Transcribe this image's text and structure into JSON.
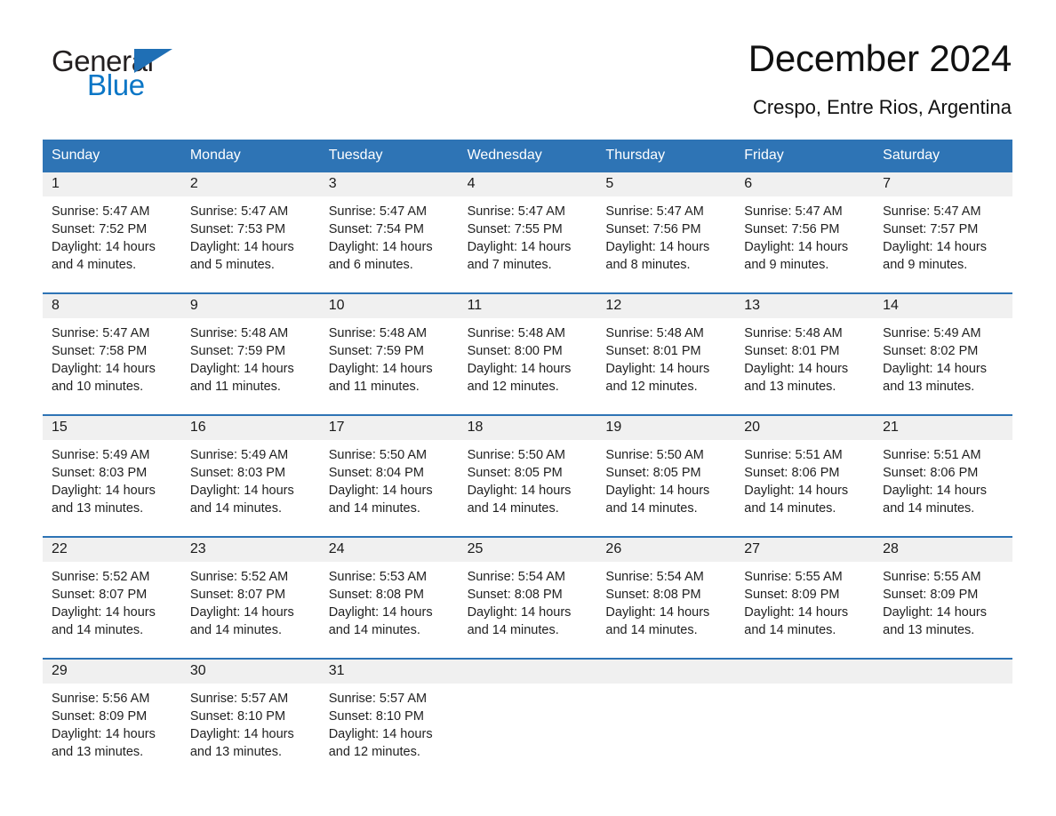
{
  "brand": {
    "name_part1": "General",
    "name_part2": "Blue",
    "logo_icon": "triangle-icon",
    "colors": {
      "blue": "#1f6fb5",
      "text": "#231f20",
      "blue_text": "#0b76c6"
    }
  },
  "header": {
    "title": "December 2024",
    "location": "Crespo, Entre Rios, Argentina"
  },
  "calendar": {
    "accent_color": "#2e74b5",
    "daynum_band_color": "#f0f0f0",
    "weekdays": [
      "Sunday",
      "Monday",
      "Tuesday",
      "Wednesday",
      "Thursday",
      "Friday",
      "Saturday"
    ],
    "weeks": [
      [
        {
          "day": "1",
          "sunrise": "Sunrise: 5:47 AM",
          "sunset": "Sunset: 7:52 PM",
          "daylight_line1": "Daylight: 14 hours",
          "daylight_line2": "and 4 minutes."
        },
        {
          "day": "2",
          "sunrise": "Sunrise: 5:47 AM",
          "sunset": "Sunset: 7:53 PM",
          "daylight_line1": "Daylight: 14 hours",
          "daylight_line2": "and 5 minutes."
        },
        {
          "day": "3",
          "sunrise": "Sunrise: 5:47 AM",
          "sunset": "Sunset: 7:54 PM",
          "daylight_line1": "Daylight: 14 hours",
          "daylight_line2": "and 6 minutes."
        },
        {
          "day": "4",
          "sunrise": "Sunrise: 5:47 AM",
          "sunset": "Sunset: 7:55 PM",
          "daylight_line1": "Daylight: 14 hours",
          "daylight_line2": "and 7 minutes."
        },
        {
          "day": "5",
          "sunrise": "Sunrise: 5:47 AM",
          "sunset": "Sunset: 7:56 PM",
          "daylight_line1": "Daylight: 14 hours",
          "daylight_line2": "and 8 minutes."
        },
        {
          "day": "6",
          "sunrise": "Sunrise: 5:47 AM",
          "sunset": "Sunset: 7:56 PM",
          "daylight_line1": "Daylight: 14 hours",
          "daylight_line2": "and 9 minutes."
        },
        {
          "day": "7",
          "sunrise": "Sunrise: 5:47 AM",
          "sunset": "Sunset: 7:57 PM",
          "daylight_line1": "Daylight: 14 hours",
          "daylight_line2": "and 9 minutes."
        }
      ],
      [
        {
          "day": "8",
          "sunrise": "Sunrise: 5:47 AM",
          "sunset": "Sunset: 7:58 PM",
          "daylight_line1": "Daylight: 14 hours",
          "daylight_line2": "and 10 minutes."
        },
        {
          "day": "9",
          "sunrise": "Sunrise: 5:48 AM",
          "sunset": "Sunset: 7:59 PM",
          "daylight_line1": "Daylight: 14 hours",
          "daylight_line2": "and 11 minutes."
        },
        {
          "day": "10",
          "sunrise": "Sunrise: 5:48 AM",
          "sunset": "Sunset: 7:59 PM",
          "daylight_line1": "Daylight: 14 hours",
          "daylight_line2": "and 11 minutes."
        },
        {
          "day": "11",
          "sunrise": "Sunrise: 5:48 AM",
          "sunset": "Sunset: 8:00 PM",
          "daylight_line1": "Daylight: 14 hours",
          "daylight_line2": "and 12 minutes."
        },
        {
          "day": "12",
          "sunrise": "Sunrise: 5:48 AM",
          "sunset": "Sunset: 8:01 PM",
          "daylight_line1": "Daylight: 14 hours",
          "daylight_line2": "and 12 minutes."
        },
        {
          "day": "13",
          "sunrise": "Sunrise: 5:48 AM",
          "sunset": "Sunset: 8:01 PM",
          "daylight_line1": "Daylight: 14 hours",
          "daylight_line2": "and 13 minutes."
        },
        {
          "day": "14",
          "sunrise": "Sunrise: 5:49 AM",
          "sunset": "Sunset: 8:02 PM",
          "daylight_line1": "Daylight: 14 hours",
          "daylight_line2": "and 13 minutes."
        }
      ],
      [
        {
          "day": "15",
          "sunrise": "Sunrise: 5:49 AM",
          "sunset": "Sunset: 8:03 PM",
          "daylight_line1": "Daylight: 14 hours",
          "daylight_line2": "and 13 minutes."
        },
        {
          "day": "16",
          "sunrise": "Sunrise: 5:49 AM",
          "sunset": "Sunset: 8:03 PM",
          "daylight_line1": "Daylight: 14 hours",
          "daylight_line2": "and 14 minutes."
        },
        {
          "day": "17",
          "sunrise": "Sunrise: 5:50 AM",
          "sunset": "Sunset: 8:04 PM",
          "daylight_line1": "Daylight: 14 hours",
          "daylight_line2": "and 14 minutes."
        },
        {
          "day": "18",
          "sunrise": "Sunrise: 5:50 AM",
          "sunset": "Sunset: 8:05 PM",
          "daylight_line1": "Daylight: 14 hours",
          "daylight_line2": "and 14 minutes."
        },
        {
          "day": "19",
          "sunrise": "Sunrise: 5:50 AM",
          "sunset": "Sunset: 8:05 PM",
          "daylight_line1": "Daylight: 14 hours",
          "daylight_line2": "and 14 minutes."
        },
        {
          "day": "20",
          "sunrise": "Sunrise: 5:51 AM",
          "sunset": "Sunset: 8:06 PM",
          "daylight_line1": "Daylight: 14 hours",
          "daylight_line2": "and 14 minutes."
        },
        {
          "day": "21",
          "sunrise": "Sunrise: 5:51 AM",
          "sunset": "Sunset: 8:06 PM",
          "daylight_line1": "Daylight: 14 hours",
          "daylight_line2": "and 14 minutes."
        }
      ],
      [
        {
          "day": "22",
          "sunrise": "Sunrise: 5:52 AM",
          "sunset": "Sunset: 8:07 PM",
          "daylight_line1": "Daylight: 14 hours",
          "daylight_line2": "and 14 minutes."
        },
        {
          "day": "23",
          "sunrise": "Sunrise: 5:52 AM",
          "sunset": "Sunset: 8:07 PM",
          "daylight_line1": "Daylight: 14 hours",
          "daylight_line2": "and 14 minutes."
        },
        {
          "day": "24",
          "sunrise": "Sunrise: 5:53 AM",
          "sunset": "Sunset: 8:08 PM",
          "daylight_line1": "Daylight: 14 hours",
          "daylight_line2": "and 14 minutes."
        },
        {
          "day": "25",
          "sunrise": "Sunrise: 5:54 AM",
          "sunset": "Sunset: 8:08 PM",
          "daylight_line1": "Daylight: 14 hours",
          "daylight_line2": "and 14 minutes."
        },
        {
          "day": "26",
          "sunrise": "Sunrise: 5:54 AM",
          "sunset": "Sunset: 8:08 PM",
          "daylight_line1": "Daylight: 14 hours",
          "daylight_line2": "and 14 minutes."
        },
        {
          "day": "27",
          "sunrise": "Sunrise: 5:55 AM",
          "sunset": "Sunset: 8:09 PM",
          "daylight_line1": "Daylight: 14 hours",
          "daylight_line2": "and 14 minutes."
        },
        {
          "day": "28",
          "sunrise": "Sunrise: 5:55 AM",
          "sunset": "Sunset: 8:09 PM",
          "daylight_line1": "Daylight: 14 hours",
          "daylight_line2": "and 13 minutes."
        }
      ],
      [
        {
          "day": "29",
          "sunrise": "Sunrise: 5:56 AM",
          "sunset": "Sunset: 8:09 PM",
          "daylight_line1": "Daylight: 14 hours",
          "daylight_line2": "and 13 minutes."
        },
        {
          "day": "30",
          "sunrise": "Sunrise: 5:57 AM",
          "sunset": "Sunset: 8:10 PM",
          "daylight_line1": "Daylight: 14 hours",
          "daylight_line2": "and 13 minutes."
        },
        {
          "day": "31",
          "sunrise": "Sunrise: 5:57 AM",
          "sunset": "Sunset: 8:10 PM",
          "daylight_line1": "Daylight: 14 hours",
          "daylight_line2": "and 12 minutes."
        },
        {
          "day": "",
          "sunrise": "",
          "sunset": "",
          "daylight_line1": "",
          "daylight_line2": ""
        },
        {
          "day": "",
          "sunrise": "",
          "sunset": "",
          "daylight_line1": "",
          "daylight_line2": ""
        },
        {
          "day": "",
          "sunrise": "",
          "sunset": "",
          "daylight_line1": "",
          "daylight_line2": ""
        },
        {
          "day": "",
          "sunrise": "",
          "sunset": "",
          "daylight_line1": "",
          "daylight_line2": ""
        }
      ]
    ]
  }
}
